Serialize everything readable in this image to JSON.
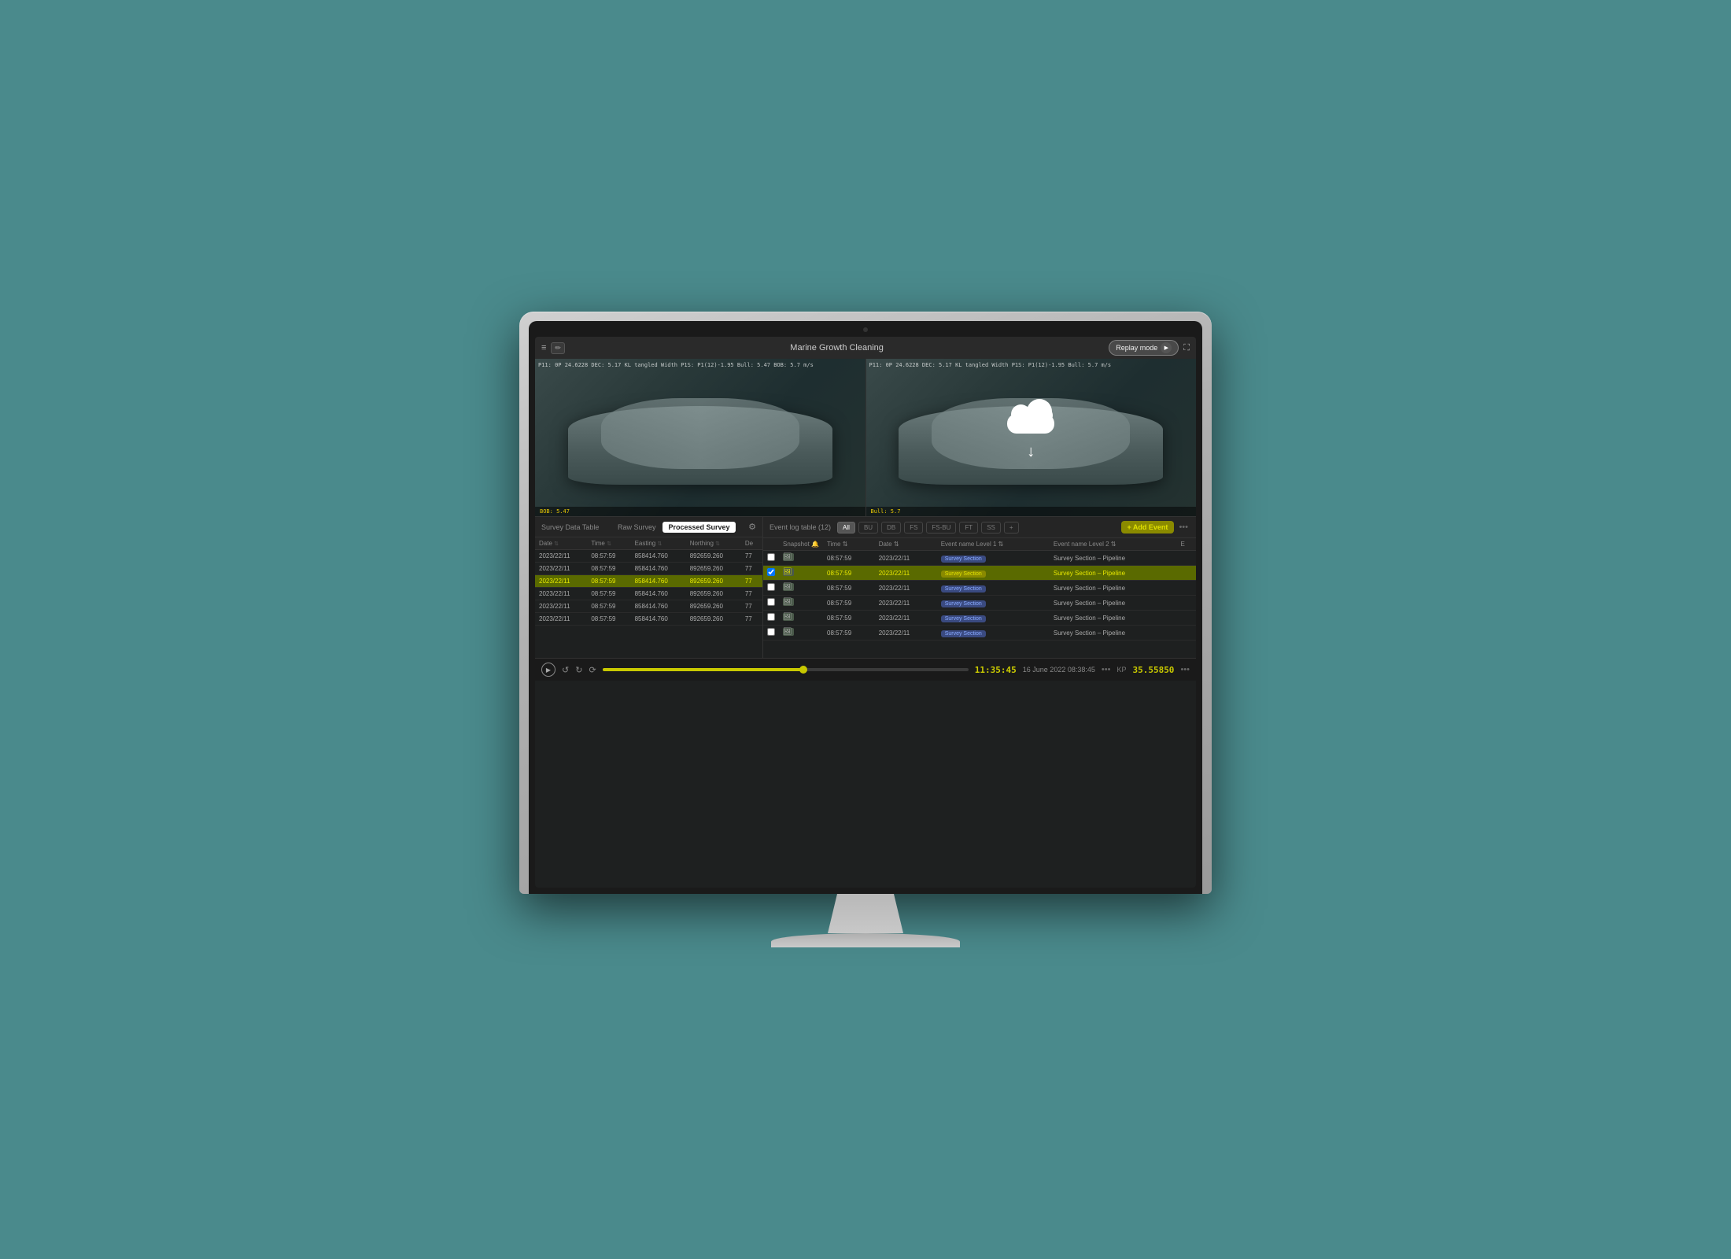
{
  "app": {
    "title": "Marine Growth Cleaning",
    "replay_mode_label": "Replay mode"
  },
  "video": {
    "left_hud": "P11: 0P 24.6228  DEC: 5.17  KL tangled Width P1S: P1(12)-1.95  Bull: 5.47  BOB: 5.7 m/s",
    "right_hud": "P11: 0P 24.6228  DEC: 5.17  KL tangled Width P1S: P1(12)-1.95  Bull: 5.7 m/s",
    "left_bottom": "BOB: 5.47",
    "right_bottom": "Bull: 5.7"
  },
  "survey_data": {
    "title": "Survey Data Table",
    "tab_raw": "Raw Survey",
    "tab_processed": "Processed Survey",
    "columns": [
      "Date",
      "Time",
      "Easting",
      "Northing",
      "De"
    ],
    "rows": [
      {
        "date": "2023/22/11",
        "time": "08:57:59",
        "easting": "858414.760",
        "northing": "892659.260",
        "dep": "77"
      },
      {
        "date": "2023/22/11",
        "time": "08:57:59",
        "easting": "858414.760",
        "northing": "892659.260",
        "dep": "77"
      },
      {
        "date": "2023/22/11",
        "time": "08:57:59",
        "easting": "858414.760",
        "northing": "892659.260",
        "dep": "77",
        "highlighted": true
      },
      {
        "date": "2023/22/11",
        "time": "08:57:59",
        "easting": "858414.760",
        "northing": "892659.260",
        "dep": "77"
      },
      {
        "date": "2023/22/11",
        "time": "08:57:59",
        "easting": "858414.760",
        "northing": "892659.260",
        "dep": "77"
      },
      {
        "date": "2023/22/11",
        "time": "08:57:59",
        "easting": "858414.760",
        "northing": "892659.260",
        "dep": "77"
      }
    ]
  },
  "event_log": {
    "title": "Event log table (12)",
    "filters": [
      "All",
      "BU",
      "DB",
      "FS",
      "FS-BU",
      "FT",
      "SS"
    ],
    "add_event_label": "+ Add Event",
    "columns": [
      "",
      "Snapshot",
      "Time",
      "Date",
      "Event name Level 1",
      "Event name Level 2",
      "E"
    ],
    "rows": [
      {
        "time": "08:57:59",
        "date": "2023/22/11",
        "level1": "Survey Section",
        "level2": "Survey Section – Pipeline"
      },
      {
        "time": "08:57:59",
        "date": "2023/22/11",
        "level1": "Survey Section",
        "level2": "Survey Section – Pipeline",
        "highlighted": true
      },
      {
        "time": "08:57:59",
        "date": "2023/22/11",
        "level1": "Survey Section",
        "level2": "Survey Section – Pipeline"
      },
      {
        "time": "08:57:59",
        "date": "2023/22/11",
        "level1": "Survey Section",
        "level2": "Survey Section – Pipeline"
      },
      {
        "time": "08:57:59",
        "date": "2023/22/11",
        "level1": "Survey Section",
        "level2": "Survey Section – Pipeline"
      },
      {
        "time": "08:57:59",
        "date": "2023/22/11",
        "level1": "Survey Section",
        "level2": "Survey Section – Pipeline"
      }
    ]
  },
  "playback": {
    "progress_percent": 55,
    "time": "11:35:45",
    "date": "16 June 2022 08:38:45",
    "kp_label": "KP",
    "kp_value": "35.55850"
  }
}
